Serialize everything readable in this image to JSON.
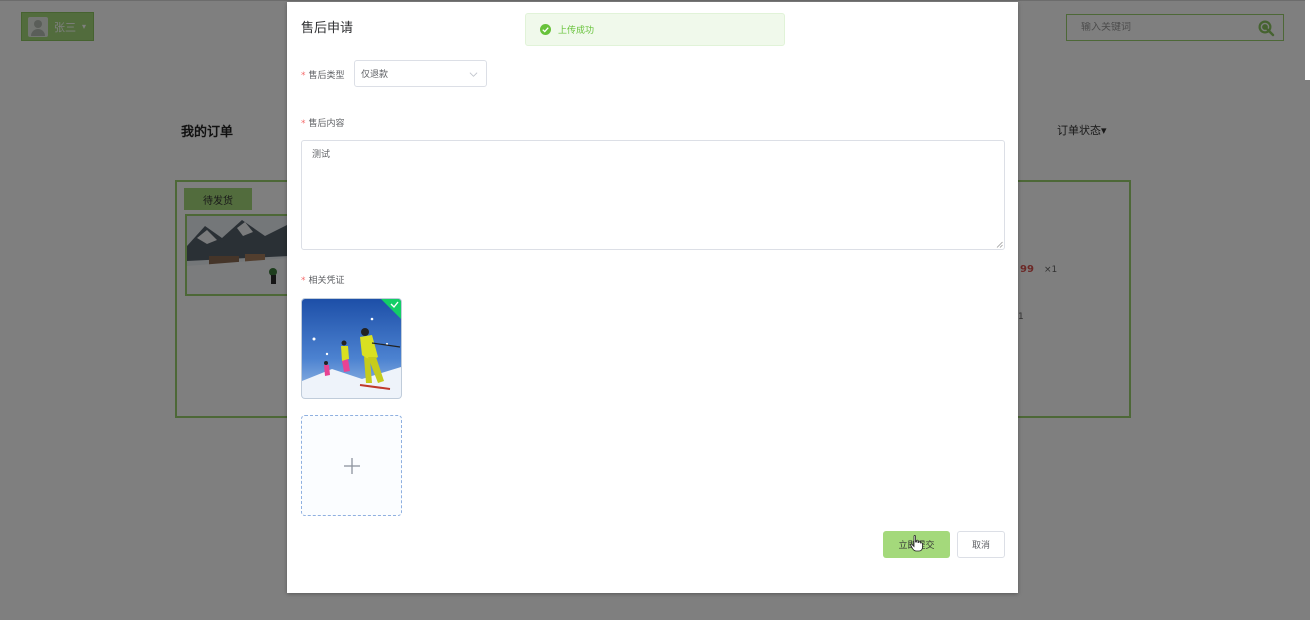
{
  "header": {
    "user_name": "张三",
    "search_placeholder": "输入关键词"
  },
  "orders": {
    "title": "我的订单",
    "status_filter": "订单状态▾",
    "card": {
      "status_tag": "待发货",
      "price_fragment": "99",
      "qty_fragment": "×1",
      "extra_fragment": "1"
    }
  },
  "dialog": {
    "title": "售后申请",
    "toast": "上传成功",
    "type_label": "售后类型",
    "type_value": "仅退款",
    "content_label": "售后内容",
    "content_value": "测试",
    "evidence_label": "相关凭证",
    "submit_label": "立即提交",
    "cancel_label": "取消",
    "required_mark": "*"
  },
  "colors": {
    "accent": "#a4d97b",
    "accent_border": "#9ad06f",
    "success": "#67c23a",
    "required": "#f56c6c"
  },
  "icons": {
    "search": "search-icon",
    "select_arrow": "chevron-down-icon",
    "upload": "plus-icon",
    "uploaded": "check-icon",
    "toast": "success-circle-icon"
  }
}
